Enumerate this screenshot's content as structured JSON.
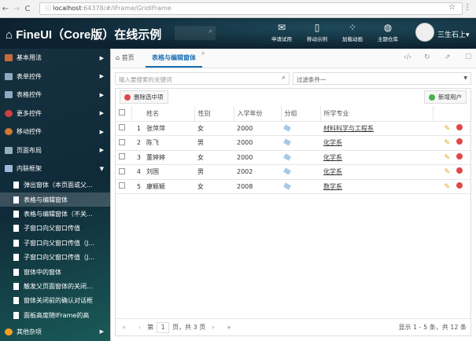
{
  "browser": {
    "url_host": "localhost",
    "url_rest": ":64378/#/IFrame/GridIFrame"
  },
  "header": {
    "title": "FineUI（Core版）在线示例",
    "buttons": [
      "申请试用",
      "移动示例",
      "加载动画",
      "主题仓库"
    ],
    "user": "三生石上"
  },
  "sidebar": {
    "items": [
      {
        "label": "基本用法",
        "color": "#c86b3a"
      },
      {
        "label": "表单控件",
        "color": "#8fa8c0"
      },
      {
        "label": "表格控件",
        "color": "#8fa8c0"
      },
      {
        "label": "更多控件",
        "color": "#d04040"
      },
      {
        "label": "移动控件",
        "color": "#d07a30"
      },
      {
        "label": "页面布局",
        "color": "#8fb0c0"
      },
      {
        "label": "内联框架",
        "color": "#a0b8d8"
      }
    ],
    "subitems": [
      "弹出窗体（本页面或父...",
      "表格与编辑窗体",
      "表格与编辑窗体（不关...",
      "子窗口向父窗口传值",
      "子窗口向父窗口传值（J...",
      "子窗口向父窗口传值（J...",
      "窗体中的窗体",
      "触发父页面窗体的关闭...",
      "窗体关闭前的确认对话框",
      "面板高度随IFrame的高"
    ],
    "active_sub": 1,
    "last": {
      "label": "其他杂项",
      "color": "#f0a020"
    }
  },
  "tabs": {
    "home": "首页",
    "active": "表格与编辑窗体"
  },
  "toolbar": {
    "search_placeholder": "输入要搜索的关键词",
    "filter": "过滤条件一",
    "delete_btn": "删除选中项",
    "add_btn": "新增用户"
  },
  "grid": {
    "columns": [
      "姓名",
      "性别",
      "入学年份",
      "分组",
      "所学专业"
    ],
    "rows": [
      {
        "n": "1",
        "name": "张萍萍",
        "gender": "女",
        "year": "2000",
        "major": "材料科学与工程系"
      },
      {
        "n": "2",
        "name": "陈飞",
        "gender": "男",
        "year": "2000",
        "major": "化学系"
      },
      {
        "n": "3",
        "name": "董婷婷",
        "gender": "女",
        "year": "2000",
        "major": "化学系"
      },
      {
        "n": "4",
        "name": "刘国",
        "gender": "男",
        "year": "2002",
        "major": "化学系"
      },
      {
        "n": "5",
        "name": "康颖颖",
        "gender": "女",
        "year": "2008",
        "major": "数学系"
      }
    ]
  },
  "pager": {
    "prefix": "第",
    "page": "1",
    "suffix": "页，共 3 页",
    "info": "显示 1 - 5 条，共 12 条"
  }
}
